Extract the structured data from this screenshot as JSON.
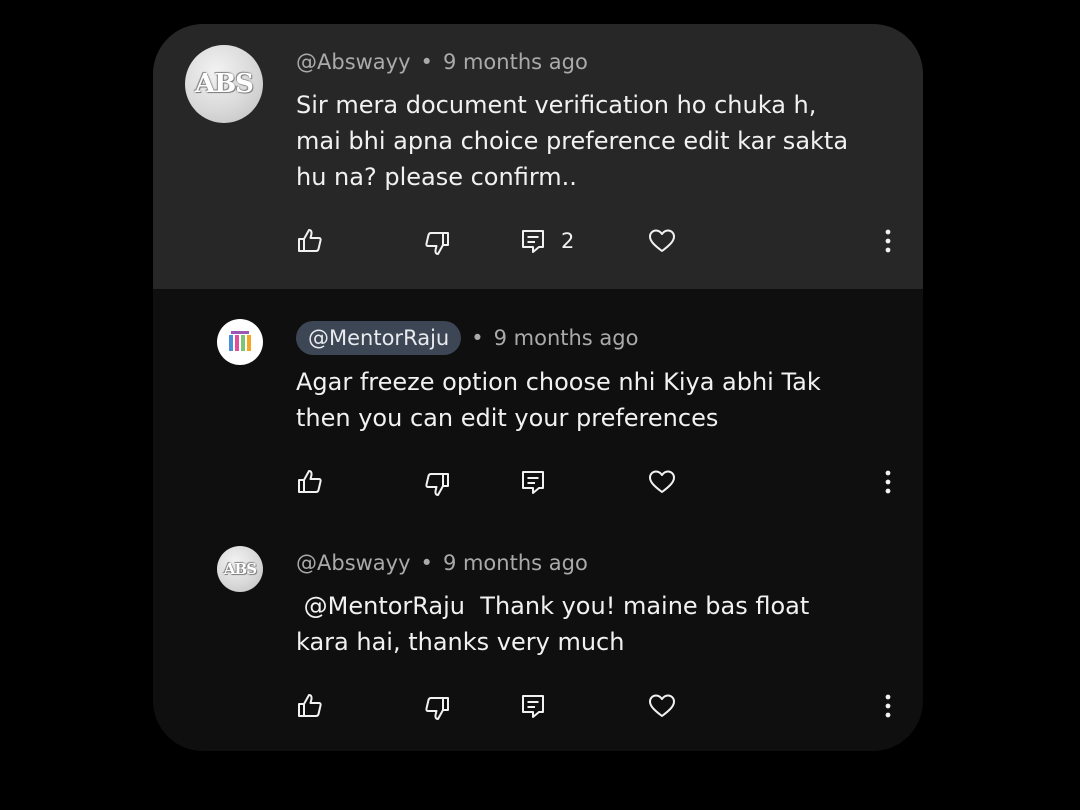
{
  "comments": [
    {
      "author": "@Abswayy",
      "dot": "•",
      "time": "9 months ago",
      "avatar_text": "ABS",
      "text": "Sir mera document verification ho chuka h,\nmai bhi apna choice preference edit kar sakta\nhu na? please confirm..",
      "reply_count": "2"
    },
    {
      "author": "@MentorRaju",
      "dot": "•",
      "time": "9 months ago",
      "text": "Agar freeze option choose nhi Kiya abhi Tak\nthen you can edit your preferences"
    },
    {
      "author": "@Abswayy",
      "dot": "•",
      "time": "9 months ago",
      "avatar_text": "ABS",
      "text": " @MentorRaju  Thank you! maine bas float\nkara hai, thanks very much"
    }
  ],
  "icons": {
    "like": "thumbs-up-icon",
    "dislike": "thumbs-down-icon",
    "reply": "comment-icon",
    "heart": "heart-icon",
    "more": "more-vertical-icon"
  },
  "colors": {
    "background": "#000000",
    "card": "#0f0f0f",
    "highlight": "#272727",
    "chip": "#3d4654",
    "meta_text": "#aaaaaa"
  }
}
